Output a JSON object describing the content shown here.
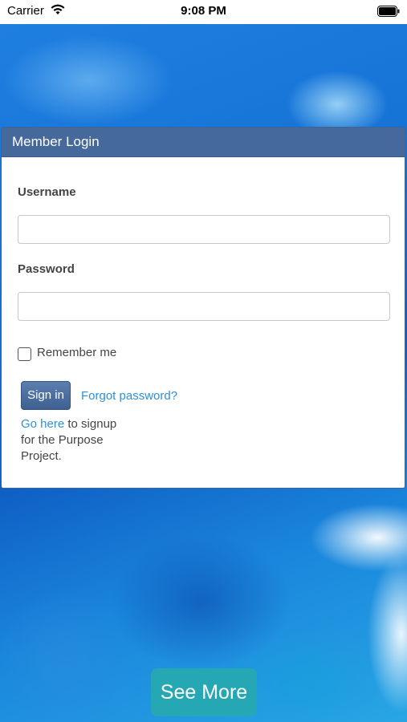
{
  "status_bar": {
    "carrier": "Carrier",
    "time": "9:08 PM",
    "wifi_icon": "wifi-icon",
    "battery_icon": "battery-icon"
  },
  "login_card": {
    "title": "Member Login",
    "username_label": "Username",
    "username_value": "",
    "password_label": "Password",
    "password_value": "",
    "remember_label": "Remember me",
    "signin_label": "Sign in",
    "forgot_label": "Forgot password?",
    "signup_link": "Go here",
    "signup_text": " to signup for the Purpose Project."
  },
  "footer": {
    "see_more_label": "See More"
  },
  "colors": {
    "card_header": "#46699b",
    "link": "#2f8fd8",
    "see_more_bg": "#26a7b4"
  }
}
